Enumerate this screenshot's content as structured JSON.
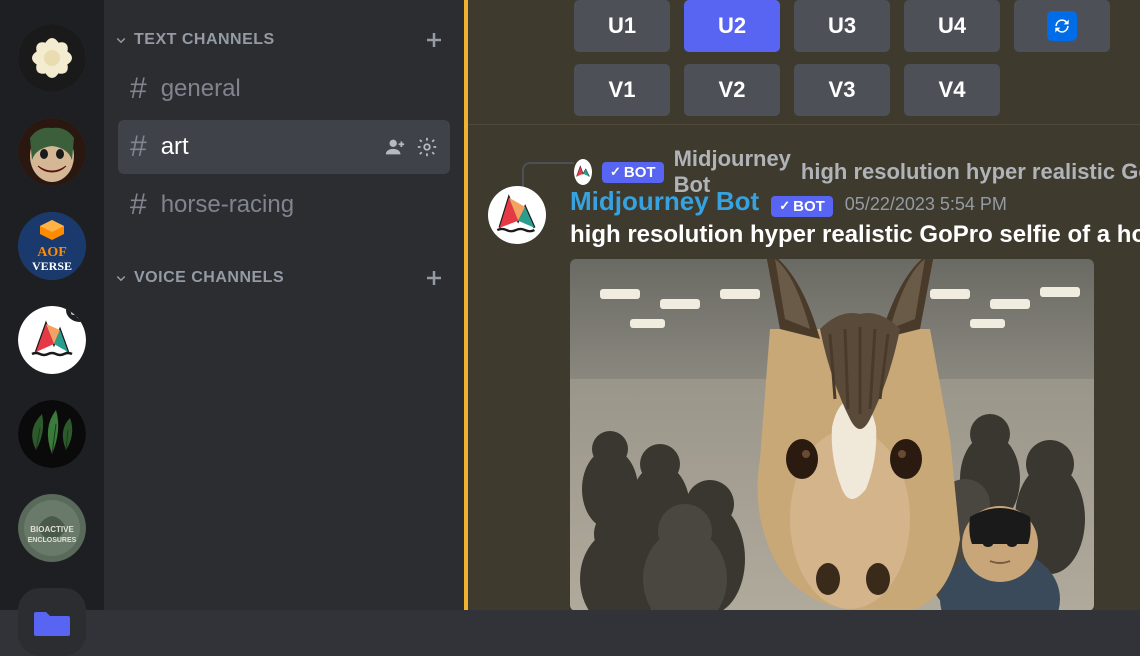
{
  "channels": {
    "text_header": "TEXT CHANNELS",
    "voice_header": "VOICE CHANNELS",
    "items": [
      {
        "name": "general",
        "active": false
      },
      {
        "name": "art",
        "active": true
      },
      {
        "name": "horse-racing",
        "active": false
      }
    ]
  },
  "buttons": {
    "row1": [
      "U1",
      "U2",
      "U3",
      "U4"
    ],
    "row2": [
      "V1",
      "V2",
      "V3",
      "V4"
    ],
    "active": "U2"
  },
  "reply": {
    "bot_label": "BOT",
    "author": "Midjourney Bot",
    "text": "high resolution hyper realistic GoPr"
  },
  "message": {
    "author": "Midjourney Bot",
    "bot_label": "BOT",
    "timestamp": "05/22/2023 5:54 PM",
    "prompt": "high resolution hyper realistic GoPro selfie of a horse"
  },
  "servers": [
    {
      "id": "flower",
      "label": "Flower server"
    },
    {
      "id": "joker",
      "label": "Joker server"
    },
    {
      "id": "aofverse",
      "label": "AOF Verse"
    },
    {
      "id": "midjourney",
      "label": "Midjourney"
    },
    {
      "id": "leaf",
      "label": "Leaf server"
    },
    {
      "id": "bioactive",
      "label": "Bioactive Enclosures"
    },
    {
      "id": "folder",
      "label": "Folder"
    }
  ]
}
